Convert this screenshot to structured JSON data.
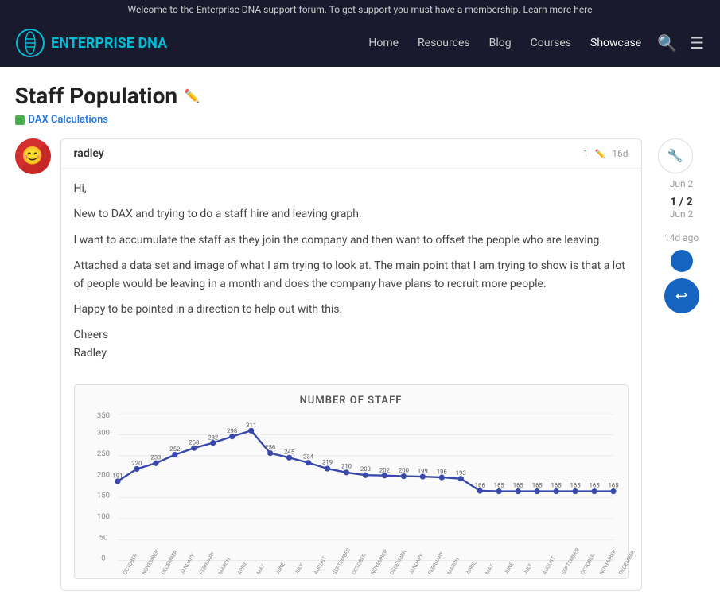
{
  "banner": {
    "text": "Welcome to the Enterprise DNA support forum. To get support you must have a membership. Learn more here"
  },
  "nav": {
    "logo_text_plain": "ENTERPRISE",
    "logo_text_accent": "DNA",
    "links": [
      {
        "label": "Home",
        "active": false
      },
      {
        "label": "Resources",
        "active": false
      },
      {
        "label": "Blog",
        "active": false
      },
      {
        "label": "Courses",
        "active": false
      },
      {
        "label": "Showcase",
        "active": true
      }
    ]
  },
  "page": {
    "title": "Staff Population",
    "category": "DAX Calculations"
  },
  "post": {
    "author": "radley",
    "post_number": "1",
    "age": "16d",
    "body_lines": [
      "Hi,",
      "New to DAX and trying to do a staff hire and leaving graph.",
      "I want to accumulate the staff as they join the company and then want to offset the people who are leaving.",
      "Attached a data set and image of what I am trying to look at. The main point that I am trying to show is that a lot of people would be leaving in a month and does the company have plans to recruit more people.",
      "Happy to be pointed in a direction to help out with this.",
      "Cheers\nRadley"
    ]
  },
  "chart": {
    "title": "NUMBER OF STAFF",
    "data": [
      {
        "label": "OCTOBER",
        "value": 191
      },
      {
        "label": "NOVEMBER",
        "value": 220
      },
      {
        "label": "DECEMBER",
        "value": 233
      },
      {
        "label": "JANUARY",
        "value": 252
      },
      {
        "label": "FEBRUARY",
        "value": 268
      },
      {
        "label": "MARCH",
        "value": 282
      },
      {
        "label": "APRIL",
        "value": 298
      },
      {
        "label": "MAY",
        "value": 311
      },
      {
        "label": "JUNE",
        "value": 256
      },
      {
        "label": "JULY",
        "value": 245
      },
      {
        "label": "AUGUST",
        "value": 234
      },
      {
        "label": "SEPTEMBER",
        "value": 219
      },
      {
        "label": "OCTOBER",
        "value": 210
      },
      {
        "label": "NOVEMBER",
        "value": 203
      },
      {
        "label": "DECEMBER",
        "value": 202
      },
      {
        "label": "JANUARY",
        "value": 200
      },
      {
        "label": "FEBRUARY",
        "value": 199
      },
      {
        "label": "MARCH",
        "value": 196
      },
      {
        "label": "APRIL",
        "value": 193
      },
      {
        "label": "MAY",
        "value": 166
      },
      {
        "label": "JUNE",
        "value": 165
      },
      {
        "label": "JULY",
        "value": 165
      },
      {
        "label": "AUGUST",
        "value": 165
      },
      {
        "label": "SEPTEMBER",
        "value": 165
      },
      {
        "label": "OCTOBER",
        "value": 165
      },
      {
        "label": "NOVEMBER",
        "value": 165
      },
      {
        "label": "DECEMBER",
        "value": 165
      }
    ],
    "y_labels": [
      0,
      50,
      100,
      150,
      200,
      250,
      300,
      350
    ]
  },
  "sidebar": {
    "tool_icon": "🔧",
    "date1": "Jun 2",
    "post_count": "1 / 2",
    "date2": "Jun 2",
    "ago": "14d ago",
    "reply_icon": "↩"
  }
}
